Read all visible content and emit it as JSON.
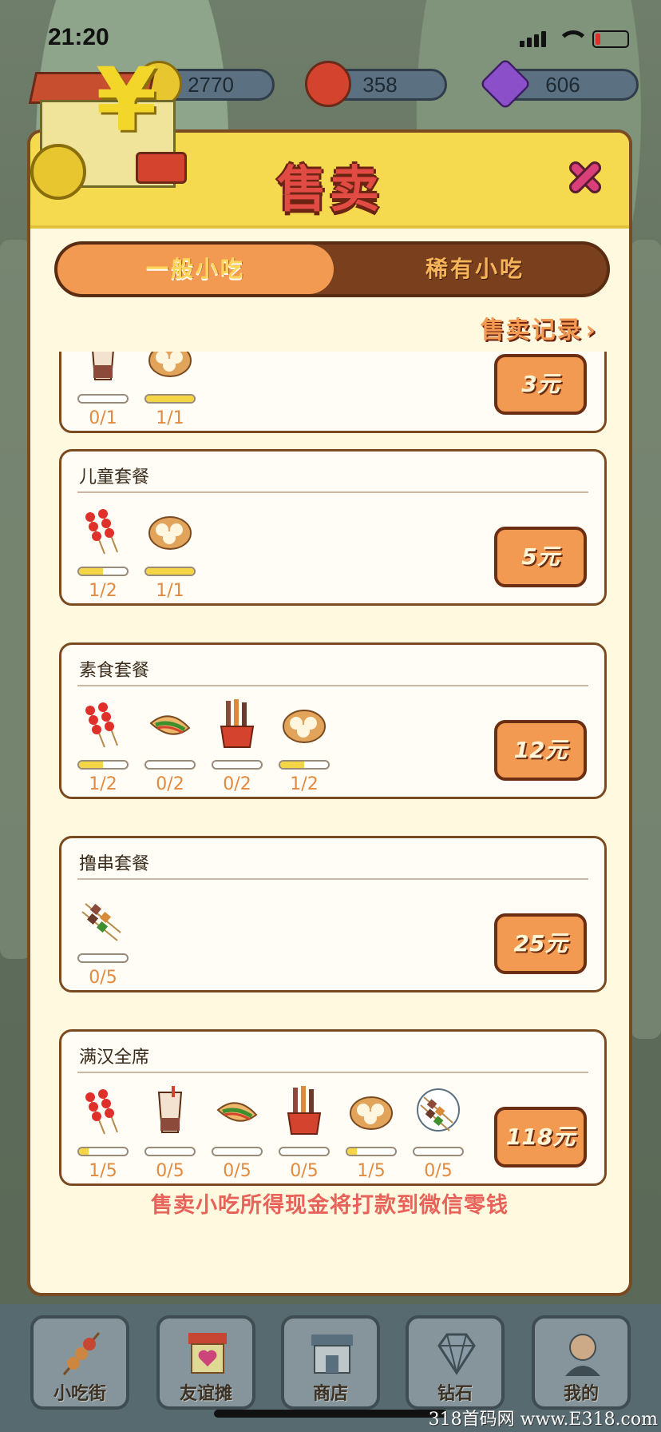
{
  "status_bar": {
    "time": "21:20"
  },
  "resources": [
    {
      "value": "2770",
      "icon": "coin-icon",
      "color": "#e8c62f"
    },
    {
      "value": "358",
      "icon": "lantern-icon",
      "color": "#d4432d"
    },
    {
      "value": "606",
      "icon": "diamond-icon",
      "color": "#8b4fc9"
    }
  ],
  "dialog": {
    "title": "售卖",
    "tabs": [
      {
        "label": "一般小吃",
        "active": true
      },
      {
        "label": "稀有小吃",
        "active": false
      }
    ],
    "records_link": "售卖记录",
    "combos": [
      {
        "name": "",
        "price": "3元",
        "items": [
          {
            "icon": "bubble-tea-icon",
            "count": "0/1",
            "progress": 0
          },
          {
            "icon": "steamed-bun-icon",
            "count": "1/1",
            "progress": 1
          }
        ]
      },
      {
        "name": "儿童套餐",
        "price": "5元",
        "items": [
          {
            "icon": "candied-haws-icon",
            "count": "1/2",
            "progress": 0.5
          },
          {
            "icon": "steamed-bun-icon",
            "count": "1/1",
            "progress": 1
          }
        ]
      },
      {
        "name": "素食套餐",
        "price": "12元",
        "items": [
          {
            "icon": "candied-haws-icon",
            "count": "1/2",
            "progress": 0.5
          },
          {
            "icon": "pancake-icon",
            "count": "0/2",
            "progress": 0
          },
          {
            "icon": "skewer-bucket-icon",
            "count": "0/2",
            "progress": 0
          },
          {
            "icon": "steamed-bun-icon",
            "count": "1/2",
            "progress": 0.5
          }
        ]
      },
      {
        "name": "撸串套餐",
        "price": "25元",
        "items": [
          {
            "icon": "kebab-icon",
            "count": "0/5",
            "progress": 0
          }
        ]
      },
      {
        "name": "满汉全席",
        "price": "118元",
        "items": [
          {
            "icon": "candied-haws-icon",
            "count": "1/5",
            "progress": 0.2
          },
          {
            "icon": "bubble-tea-icon",
            "count": "0/5",
            "progress": 0
          },
          {
            "icon": "pancake-icon",
            "count": "0/5",
            "progress": 0
          },
          {
            "icon": "skewer-bucket-icon",
            "count": "0/5",
            "progress": 0
          },
          {
            "icon": "steamed-bun-icon",
            "count": "1/5",
            "progress": 0.2
          },
          {
            "icon": "kebab-icon",
            "count": "0/5",
            "progress": 0
          }
        ]
      }
    ],
    "footer_note": "售卖小吃所得现金将打款到微信零钱"
  },
  "bottom_nav": [
    {
      "label": "小吃街",
      "icon": "skewer-icon"
    },
    {
      "label": "友谊摊",
      "icon": "heart-stall-icon"
    },
    {
      "label": "商店",
      "icon": "store-icon"
    },
    {
      "label": "钻石",
      "icon": "diamond-icon"
    },
    {
      "label": "我的",
      "icon": "profile-icon"
    }
  ],
  "watermark": "318首码网 www.E318.com"
}
